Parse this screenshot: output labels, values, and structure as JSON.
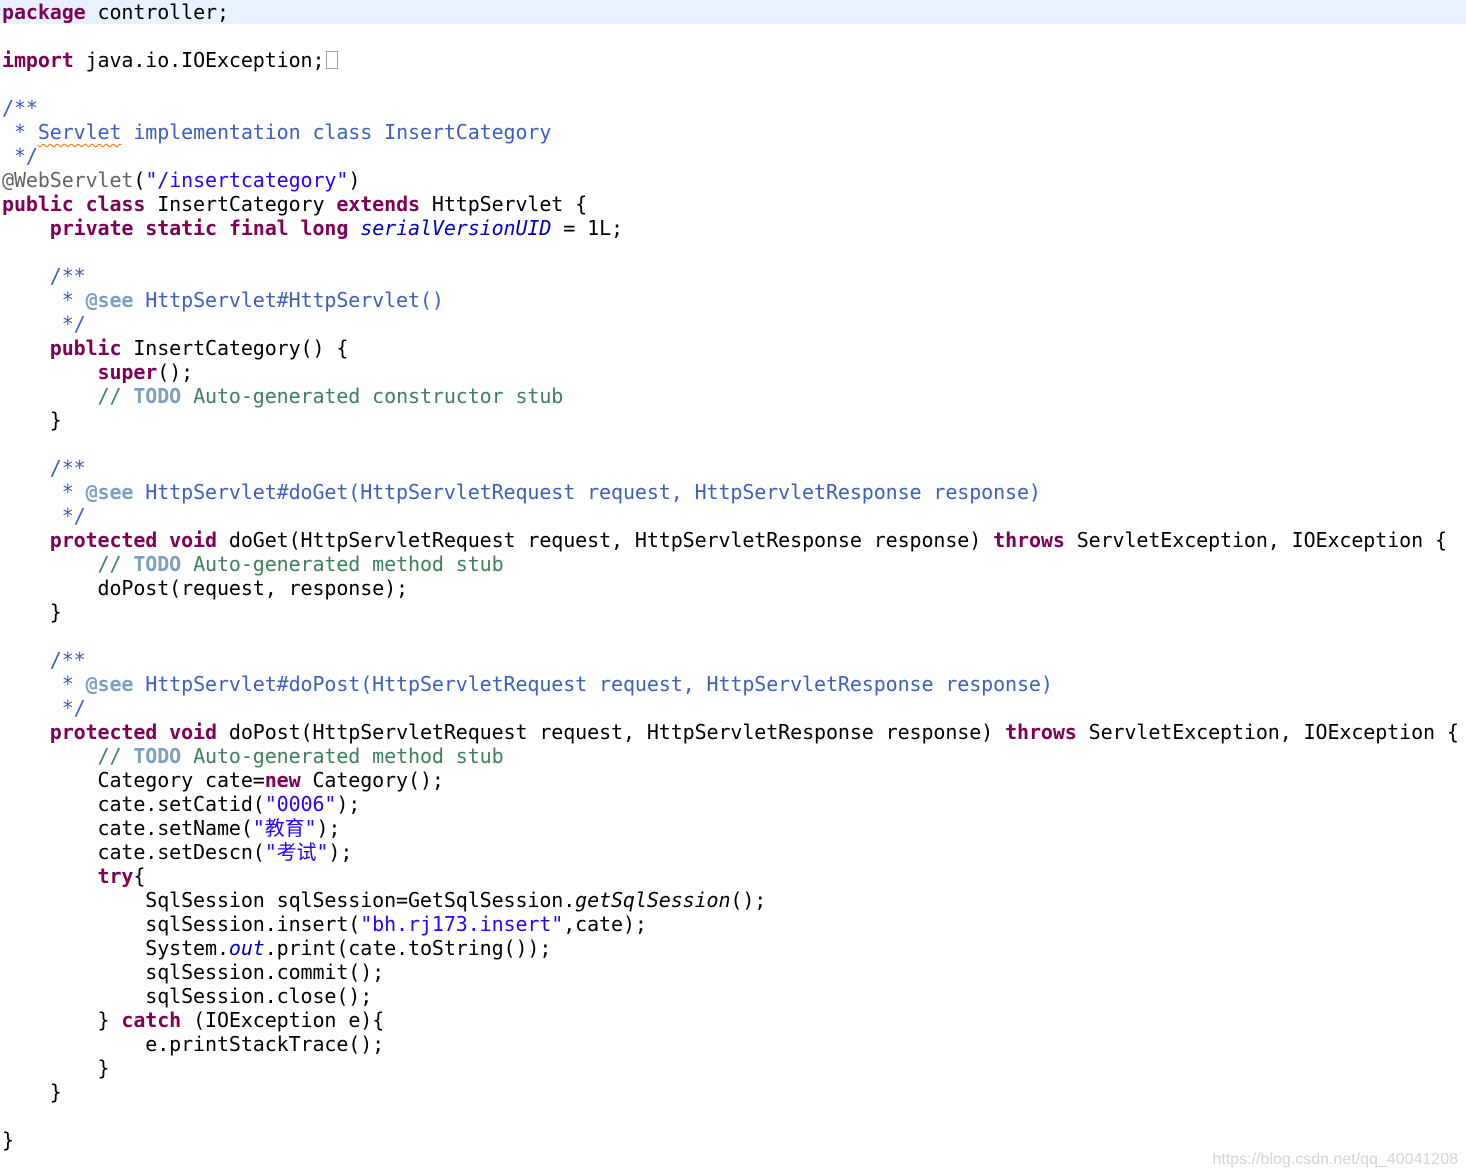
{
  "editor": {
    "line1": {
      "kw": "package",
      "rest": " controller;"
    },
    "line3": {
      "kw": "import",
      "rest": " java.io.IOException;"
    },
    "line5": "/**",
    "line6": {
      "pre": " * ",
      "sq": "Servlet",
      "rest": " implementation class InsertCategory"
    },
    "line7": " */",
    "line8": {
      "ann": "@WebServlet",
      "p1": "(",
      "str": "\"/insertcategory\"",
      "p2": ")"
    },
    "line9": {
      "kw1": "public class",
      "t1": " InsertCategory ",
      "kw2": "extends",
      "t2": " HttpServlet {"
    },
    "line10": {
      "ind": "    ",
      "kw": "private static final long",
      "sp": " ",
      "field": "serialVersionUID",
      "rest": " = 1L;"
    },
    "line12": "    /**",
    "line13": {
      "pre": "     * ",
      "tag": "@see",
      "rest": " HttpServlet#HttpServlet()"
    },
    "line14": "     */",
    "line15": {
      "ind": "    ",
      "kw": "public",
      "rest": " InsertCategory() {"
    },
    "line16": {
      "ind": "        ",
      "kw": "super",
      "rest": "();"
    },
    "line17": {
      "ind": "        ",
      "c1": "// ",
      "todo": "TODO",
      "c2": " Auto-generated constructor stub"
    },
    "line18": "    }",
    "line20": "    /**",
    "line21": {
      "pre": "     * ",
      "tag": "@see",
      "rest": " HttpServlet#doGet(HttpServletRequest request, HttpServletResponse response)"
    },
    "line22": "     */",
    "line23": {
      "ind": "    ",
      "kw1": "protected void",
      "t1": " doGet(HttpServletRequest request, HttpServletResponse response) ",
      "kw2": "throws",
      "t2": " ServletException, IOException {"
    },
    "line24": {
      "ind": "        ",
      "c1": "// ",
      "todo": "TODO",
      "c2": " Auto-generated method stub"
    },
    "line25": "        doPost(request, response);",
    "line26": "    }",
    "line28": "    /**",
    "line29": {
      "pre": "     * ",
      "tag": "@see",
      "rest": " HttpServlet#doPost(HttpServletRequest request, HttpServletResponse response)"
    },
    "line30": "     */",
    "line31": {
      "ind": "    ",
      "kw1": "protected void",
      "t1": " doPost(HttpServletRequest request, HttpServletResponse response) ",
      "kw2": "throws",
      "t2": " ServletException, IOException {"
    },
    "line32": {
      "ind": "        ",
      "c1": "// ",
      "todo": "TODO",
      "c2": " Auto-generated method stub"
    },
    "line33": {
      "pre": "        Category cate=",
      "kw": "new",
      "rest": " Category();"
    },
    "line34": {
      "pre": "        cate.setCatid(",
      "str": "\"0006\"",
      "rest": ");"
    },
    "line35": {
      "pre": "        cate.setName(",
      "str": "\"教育\"",
      "rest": ");"
    },
    "line36": {
      "pre": "        cate.setDescn(",
      "str": "\"考试\"",
      "rest": ");"
    },
    "line37": {
      "ind": "        ",
      "kw": "try",
      "rest": "{"
    },
    "line38": {
      "pre": "            SqlSession sqlSession=GetSqlSession.",
      "it": "getSqlSession",
      "rest": "();"
    },
    "line39": {
      "pre": "            sqlSession.insert(",
      "str": "\"bh.rj173.insert\"",
      "rest": ",cate);"
    },
    "line40": {
      "pre": "            System.",
      "field": "out",
      "rest": ".print(cate.toString());"
    },
    "line41": "            sqlSession.commit();",
    "line42": "            sqlSession.close();",
    "line43": {
      "pre": "        } ",
      "kw": "catch",
      "rest": " (IOException e){"
    },
    "line44": "            e.printStackTrace();",
    "line45": "        }",
    "line46": "    }",
    "line48": "}"
  },
  "watermark": "https://blog.csdn.net/qq_40041208"
}
